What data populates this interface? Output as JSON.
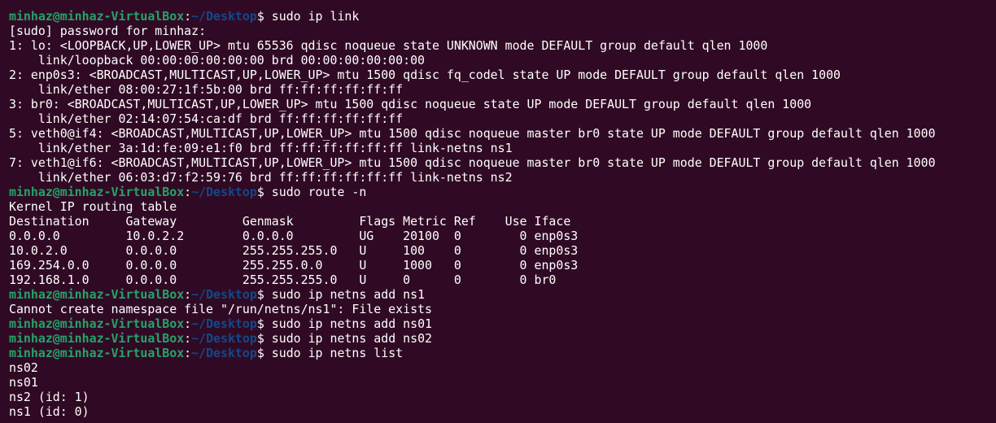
{
  "colors": {
    "background": "#300a24",
    "prompt_user": "#26a269",
    "prompt_path": "#12488b",
    "text": "#ffffff"
  },
  "prompt": {
    "user_host": "minhaz@minhaz-VirtualBox",
    "colon": ":",
    "path": "~/Desktop",
    "dollar": "$ "
  },
  "lines": [
    {
      "type": "cmd",
      "text": "sudo ip link"
    },
    {
      "type": "out",
      "text": "[sudo] password for minhaz:"
    },
    {
      "type": "out",
      "text": "1: lo: <LOOPBACK,UP,LOWER_UP> mtu 65536 qdisc noqueue state UNKNOWN mode DEFAULT group default qlen 1000"
    },
    {
      "type": "out",
      "text": "    link/loopback 00:00:00:00:00:00 brd 00:00:00:00:00:00"
    },
    {
      "type": "out",
      "text": "2: enp0s3: <BROADCAST,MULTICAST,UP,LOWER_UP> mtu 1500 qdisc fq_codel state UP mode DEFAULT group default qlen 1000"
    },
    {
      "type": "out",
      "text": "    link/ether 08:00:27:1f:5b:00 brd ff:ff:ff:ff:ff:ff"
    },
    {
      "type": "out",
      "text": "3: br0: <BROADCAST,MULTICAST,UP,LOWER_UP> mtu 1500 qdisc noqueue state UP mode DEFAULT group default qlen 1000"
    },
    {
      "type": "out",
      "text": "    link/ether 02:14:07:54:ca:df brd ff:ff:ff:ff:ff:ff"
    },
    {
      "type": "out",
      "text": "5: veth0@if4: <BROADCAST,MULTICAST,UP,LOWER_UP> mtu 1500 qdisc noqueue master br0 state UP mode DEFAULT group default qlen 1000"
    },
    {
      "type": "out",
      "text": "    link/ether 3a:1d:fe:09:e1:f0 brd ff:ff:ff:ff:ff:ff link-netns ns1"
    },
    {
      "type": "out",
      "text": "7: veth1@if6: <BROADCAST,MULTICAST,UP,LOWER_UP> mtu 1500 qdisc noqueue master br0 state UP mode DEFAULT group default qlen 1000"
    },
    {
      "type": "out",
      "text": "    link/ether 06:03:d7:f2:59:76 brd ff:ff:ff:ff:ff:ff link-netns ns2"
    },
    {
      "type": "cmd",
      "text": "sudo route -n"
    },
    {
      "type": "out",
      "text": "Kernel IP routing table"
    },
    {
      "type": "out",
      "text": "Destination     Gateway         Genmask         Flags Metric Ref    Use Iface"
    },
    {
      "type": "out",
      "text": "0.0.0.0         10.0.2.2        0.0.0.0         UG    20100  0        0 enp0s3"
    },
    {
      "type": "out",
      "text": "10.0.2.0        0.0.0.0         255.255.255.0   U     100    0        0 enp0s3"
    },
    {
      "type": "out",
      "text": "169.254.0.0     0.0.0.0         255.255.0.0     U     1000   0        0 enp0s3"
    },
    {
      "type": "out",
      "text": "192.168.1.0     0.0.0.0         255.255.255.0   U     0      0        0 br0"
    },
    {
      "type": "cmd",
      "text": "sudo ip netns add ns1"
    },
    {
      "type": "out",
      "text": "Cannot create namespace file \"/run/netns/ns1\": File exists"
    },
    {
      "type": "cmd",
      "text": "sudo ip netns add ns01"
    },
    {
      "type": "cmd",
      "text": "sudo ip netns add ns02"
    },
    {
      "type": "cmd",
      "text": "sudo ip netns list"
    },
    {
      "type": "out",
      "text": "ns02"
    },
    {
      "type": "out",
      "text": "ns01"
    },
    {
      "type": "out",
      "text": "ns2 (id: 1)"
    },
    {
      "type": "out",
      "text": "ns1 (id: 0)"
    }
  ]
}
